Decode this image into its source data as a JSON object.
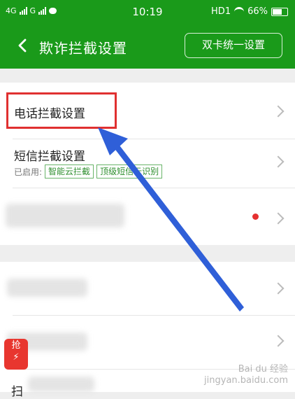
{
  "status_bar": {
    "carrier_left": "4G",
    "carrier_right": "G",
    "time": "10:19",
    "network": "HD1",
    "battery": "66%"
  },
  "nav": {
    "title": "欺诈拦截设置",
    "dual_card_button": "双卡统一设置"
  },
  "settings": {
    "phone_block": "电话拦截设置",
    "sms_block": "短信拦截设置",
    "sms_enabled_prefix": "已启用:",
    "sms_tags": [
      "智能云拦截",
      "顶级短信云识别"
    ]
  },
  "fab": {
    "label": "抢"
  },
  "partial_row_label": "扫",
  "watermark": {
    "line1": "Bai du 经验",
    "line2": "jingyan.baidu.com"
  },
  "colors": {
    "header_green": "#1a9a1a",
    "highlight_red": "#e03030",
    "tag_green": "#2f8f2f",
    "arrow_blue": "#2f5fd8"
  }
}
